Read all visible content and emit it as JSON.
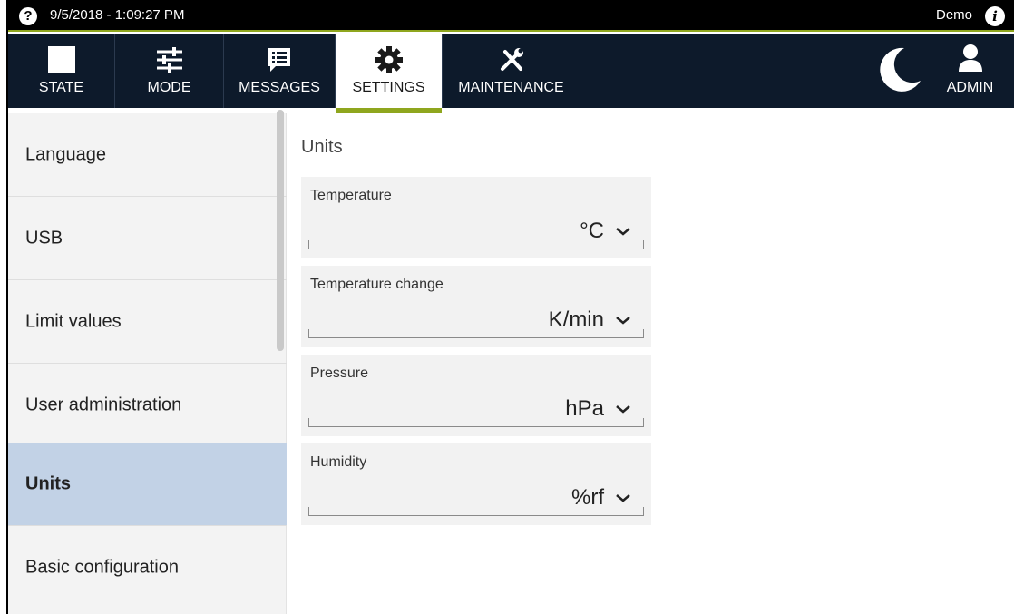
{
  "statusbar": {
    "datetime": "9/5/2018 - 1:09:27 PM",
    "user_mode": "Demo",
    "help_glyph": "?",
    "info_glyph": "i"
  },
  "nav": {
    "tabs": [
      {
        "label": "STATE",
        "icon": "stop-square-icon"
      },
      {
        "label": "MODE",
        "icon": "sliders-icon"
      },
      {
        "label": "MESSAGES",
        "icon": "message-list-icon"
      },
      {
        "label": "SETTINGS",
        "icon": "gear-icon",
        "active": true
      },
      {
        "label": "MAINTENANCE",
        "icon": "tools-icon"
      }
    ],
    "night_mode_icon": "moon-icon",
    "user": {
      "label": "ADMIN",
      "icon": "user-icon"
    }
  },
  "menu": {
    "items": [
      {
        "label": "Language"
      },
      {
        "label": "USB"
      },
      {
        "label": "Limit values"
      },
      {
        "label": "User administration"
      },
      {
        "label": "Units",
        "selected": true
      },
      {
        "label": "Basic configuration"
      }
    ]
  },
  "content": {
    "title": "Units",
    "fields": [
      {
        "label": "Temperature",
        "value": "°C"
      },
      {
        "label": "Temperature change",
        "value": "K/min"
      },
      {
        "label": "Pressure",
        "value": "hPa"
      },
      {
        "label": "Humidity",
        "value": "%rf"
      }
    ]
  },
  "colors": {
    "accent": "#8fa61e",
    "navbar": "#0d1a2b",
    "menu_selected": "#c2d2e6"
  }
}
